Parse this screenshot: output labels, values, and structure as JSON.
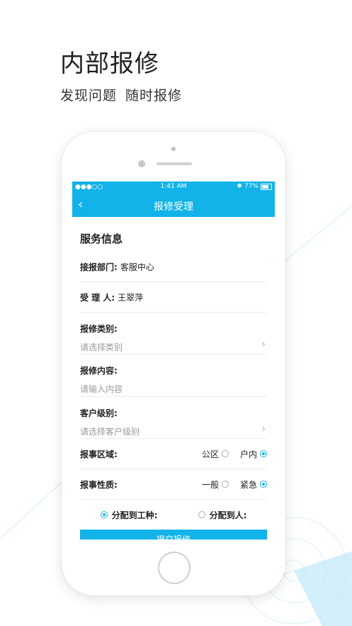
{
  "promo": {
    "headline": "内部报修",
    "sub1": "发现问题",
    "sub2": "随时报修"
  },
  "status": {
    "signal": "●●●○○",
    "wifi": "wifi-icon",
    "time": "1:41 AM",
    "battery": "77%"
  },
  "nav": {
    "title": "报修受理",
    "back_icon": "chevron-left-icon"
  },
  "form": {
    "section_title": "服务信息",
    "dept_label": "接报部门:",
    "dept_value": "客服中心",
    "receiver_label": "受 理 人:",
    "receiver_value": "王翠萍",
    "category_label": "报修类别:",
    "category_placeholder": "请选择类别",
    "content_label": "报修内容:",
    "content_placeholder": "请输入内容",
    "level_label": "客户级别:",
    "level_placeholder": "请选择客户级别",
    "area_label": "报事区域:",
    "area_opt1": "公区",
    "area_opt2": "户内",
    "area_selected": "户内",
    "nature_label": "报事性质:",
    "nature_opt1": "一般",
    "nature_opt2": "紧急",
    "nature_selected": "紧急",
    "assign_opt1": "分配到工种:",
    "assign_opt2": "分配到人:",
    "assign_selected": "分配到工种:",
    "submit_label": "提交报修"
  },
  "colors": {
    "accent": "#11b3e9",
    "deco": "#bfe8f8"
  }
}
